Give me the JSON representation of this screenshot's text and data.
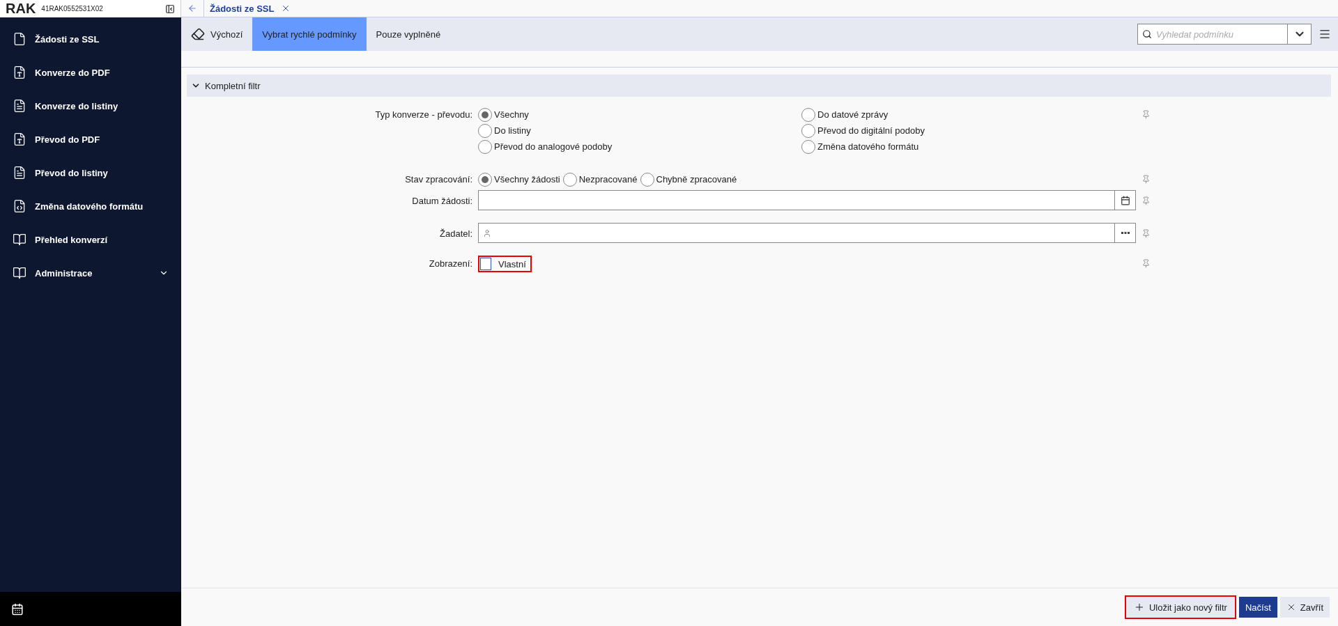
{
  "sidebar": {
    "logo": "RAK",
    "code": "41RAK0552531X02",
    "items": [
      {
        "label": "Žádosti ze SSL",
        "kind": "request",
        "expandable": false
      },
      {
        "label": "Konverze do PDF",
        "kind": "pdf",
        "expandable": false
      },
      {
        "label": "Konverze do listiny",
        "kind": "list",
        "expandable": false
      },
      {
        "label": "Převod do PDF",
        "kind": "pdf",
        "expandable": false
      },
      {
        "label": "Převod do listiny",
        "kind": "list",
        "expandable": false
      },
      {
        "label": "Změna datového formátu",
        "kind": "format",
        "expandable": false
      },
      {
        "label": "Přehled konverzí",
        "kind": "book",
        "expandable": false
      },
      {
        "label": "Administrace",
        "kind": "book",
        "expandable": true
      }
    ]
  },
  "tabs": [
    {
      "label": "Žádosti ze SSL",
      "selected": true
    }
  ],
  "toolbar": {
    "buttons": [
      {
        "label": "Výchozí",
        "kind": "eraser",
        "selected": false
      },
      {
        "label": "Vybrat rychlé podmínky",
        "kind": "plain",
        "selected": true
      },
      {
        "label": "Pouze vyplněné",
        "kind": "plain",
        "selected": false
      }
    ],
    "search": {
      "placeholder": "Vyhledat podmínku"
    }
  },
  "filter": {
    "title": "Kompletní filtr",
    "expanded": true,
    "rows": [
      {
        "kind": "radio-grid",
        "label": "Typ konverze - převodu:",
        "options": [
          {
            "label": "Všechny",
            "selected": true
          },
          {
            "label": "Do listiny",
            "selected": false
          },
          {
            "label": "Převod do analogové podoby",
            "selected": false
          },
          {
            "label": "Do datové zprávy",
            "selected": false
          },
          {
            "label": "Převod do digitální podoby",
            "selected": false
          },
          {
            "label": "Změna datového formátu",
            "selected": false
          }
        ]
      },
      {
        "kind": "radio",
        "label": "Stav zpracování:",
        "options": [
          {
            "label": "Všechny žádosti",
            "selected": true
          },
          {
            "label": "Nezpracované",
            "selected": false
          },
          {
            "label": "Chybně zpracované",
            "selected": false
          }
        ]
      },
      {
        "kind": "date",
        "label": "Datum žádosti:"
      },
      {
        "kind": "person",
        "label": "Žadatel:"
      },
      {
        "kind": "checkbox",
        "label": "Zobrazení:",
        "option": "Vlastní",
        "checked": false,
        "highlighted": true
      }
    ]
  },
  "footer": {
    "buttons": [
      {
        "label": "Uložit jako nový filtr",
        "kind": "add",
        "highlighted": true
      },
      {
        "label": "Načíst",
        "kind": "primary",
        "highlighted": false
      },
      {
        "label": "Zavřít",
        "kind": "close",
        "highlighted": false
      }
    ]
  }
}
